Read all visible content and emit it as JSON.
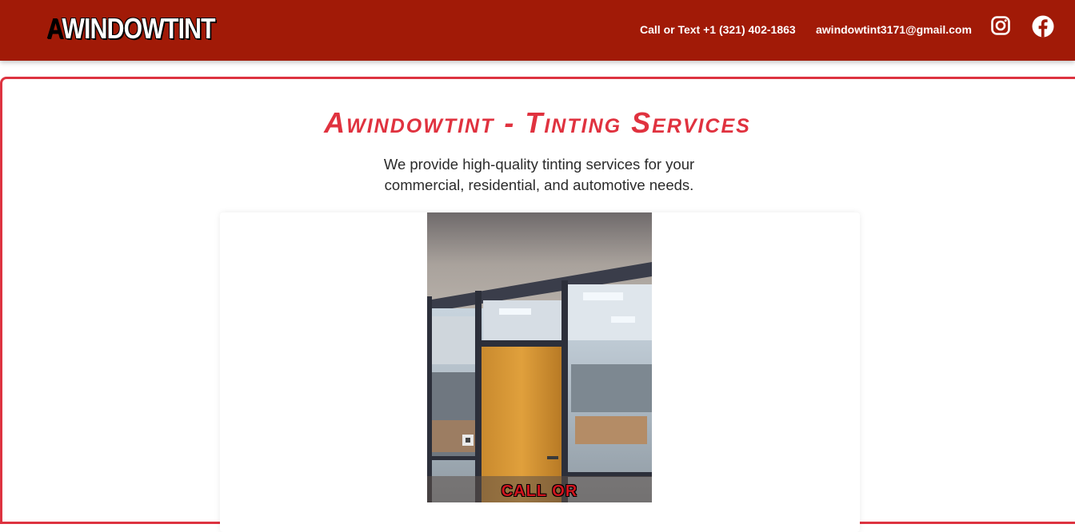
{
  "header": {
    "logo_first_letter": "A",
    "logo_rest": "WINDOWTINT",
    "phone": "Call or Text +1 (321) 402-1863",
    "email": "awindowtint3171@gmail.com",
    "social": [
      {
        "name": "instagram",
        "icon": "instagram-icon"
      },
      {
        "name": "facebook",
        "icon": "facebook-icon"
      }
    ]
  },
  "hero": {
    "title": "Awindowtint - Tinting Services",
    "subtitle": "We provide high-quality tinting services for your commercial, residential, and automotive needs."
  },
  "photo": {
    "caption": "CALL OR"
  },
  "colors": {
    "header_bg": "#a11a07",
    "accent": "#e0323f",
    "panel_border": "#dd3340"
  }
}
